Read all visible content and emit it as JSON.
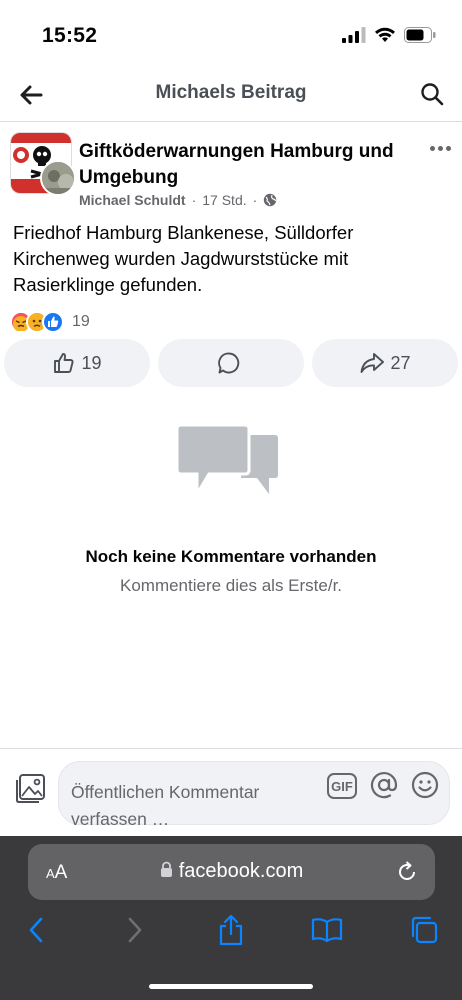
{
  "status": {
    "time": "15:52"
  },
  "nav": {
    "title": "Michaels Beitrag"
  },
  "post": {
    "group_name": "Giftköderwarnungen Hamburg und Umgebung",
    "author": "Michael Schuldt",
    "time_ago": "17 Std.",
    "separator": "·",
    "privacy_icon": "globe-icon",
    "text": "Friedhof Hamburg Blankenese, Sülldorfer Kirchenweg wurden Jagdwurststücke mit Rasierklinge gefunden.",
    "reactions": {
      "types": [
        "angry",
        "sad",
        "like"
      ],
      "count": "19"
    }
  },
  "actions": {
    "like_count": "19",
    "comment_count": "",
    "share_count": "27"
  },
  "empty": {
    "title": "Noch keine Kommentare vorhanden",
    "subtitle": "Kommentiere dies als Erste/r."
  },
  "composer": {
    "placeholder": "Öffentlichen Kommentar verfassen …",
    "gif_label": "GIF"
  },
  "browser": {
    "aa_big": "A",
    "aa_small": "A",
    "url": "facebook.com"
  },
  "colors": {
    "facebook_text": "#050505",
    "secondary_text": "#65676b",
    "button_bg": "#f0f2f5",
    "safari_blue": "#0a84ff",
    "safari_bar": "#3a3a3c"
  }
}
